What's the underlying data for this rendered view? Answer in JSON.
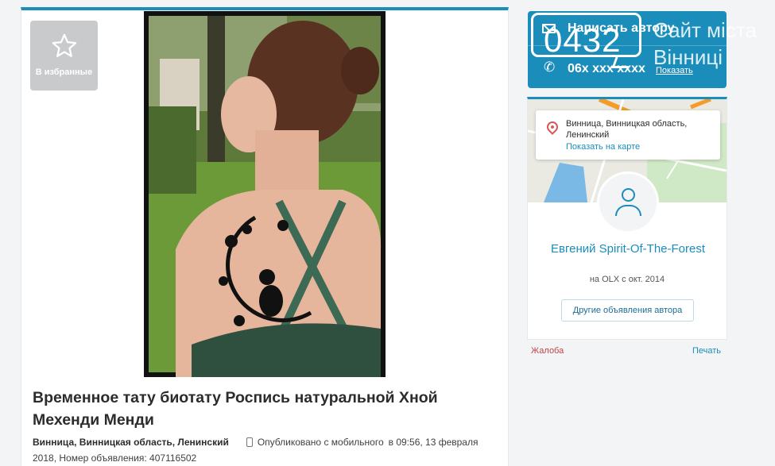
{
  "favorite": {
    "label": "В избранные",
    "icon": "star-icon"
  },
  "ad": {
    "title": "Временное тату биотату Роспись натуральной Хной Мехенди Менди",
    "location": "Винница, Винницкая область, Ленинский",
    "published_mobile": "Опубликовано с мобильного",
    "published_time": "в 09:56, 13 февраля 2018, Номер объявления: 407116502"
  },
  "contact": {
    "message_label": "Написать автору",
    "phone": "06х ххх хххх",
    "show_phone": "Показать"
  },
  "watermark": {
    "number": "0432",
    "site": "Сайт міста",
    "city": "Вінниці"
  },
  "seller": {
    "address": "Винница, Винницкая область, Ленинский",
    "show_on_map": "Показать на карте",
    "name": "Евгений Spirit-Of-The-Forest",
    "since": "на OLX с окт. 2014",
    "other_ads": "Другие объявления автора"
  },
  "footer_links": {
    "complaint": "Жалоба",
    "print": "Печать"
  },
  "colors": {
    "accent": "#1b8dbb",
    "complaint": "#c04545"
  }
}
